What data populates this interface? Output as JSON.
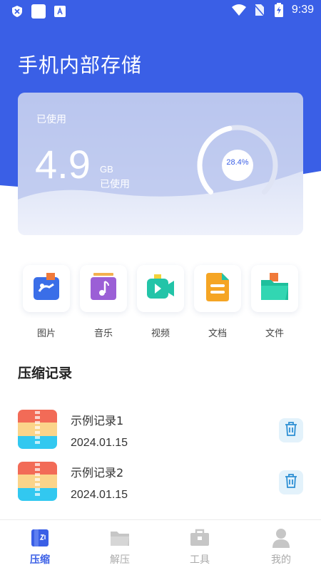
{
  "status_bar": {
    "time": "9:39"
  },
  "page": {
    "title": "手机内部存储"
  },
  "storage": {
    "used_label": "已使用",
    "used_value": "4.9",
    "unit": "GB",
    "used_sub": "已使用",
    "percent_text": "28.4%",
    "percent": 0.284
  },
  "categories": [
    {
      "label": "图片",
      "icon": "image-icon"
    },
    {
      "label": "音乐",
      "icon": "music-icon"
    },
    {
      "label": "视频",
      "icon": "video-icon"
    },
    {
      "label": "文档",
      "icon": "document-icon"
    },
    {
      "label": "文件",
      "icon": "folder-icon"
    }
  ],
  "records_section": {
    "title": "压缩记录"
  },
  "records": [
    {
      "name": "示例记录1",
      "date": "2024.01.15"
    },
    {
      "name": "示例记录2",
      "date": "2024.01.15"
    }
  ],
  "nav": [
    {
      "label": "压缩",
      "active": true
    },
    {
      "label": "解压",
      "active": false
    },
    {
      "label": "工具",
      "active": false
    },
    {
      "label": "我的",
      "active": false
    }
  ],
  "colors": {
    "primary": "#3a5fe6",
    "background": "#ffffff",
    "delete_bg": "#e3f2fb"
  }
}
